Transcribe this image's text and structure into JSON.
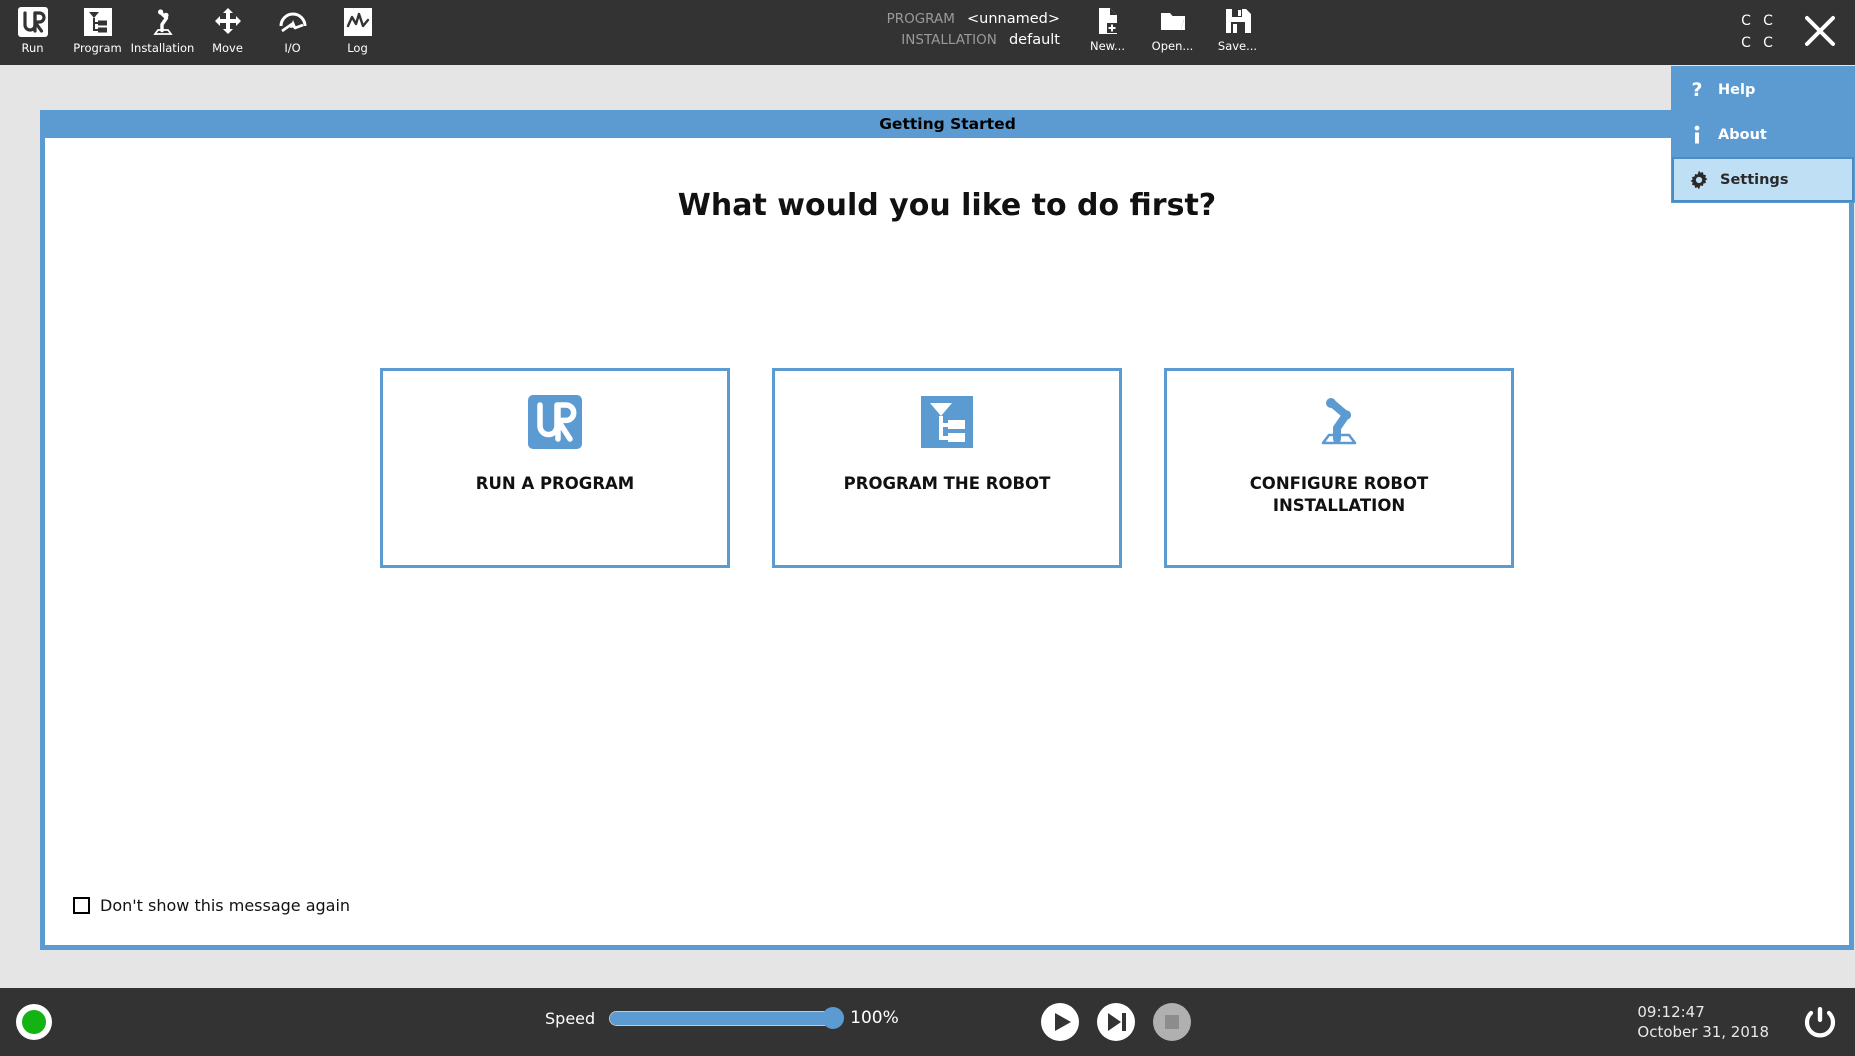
{
  "toolbar": {
    "items": [
      {
        "label": "Run",
        "icon": "ur-logo-icon"
      },
      {
        "label": "Program",
        "icon": "program-tree-icon"
      },
      {
        "label": "Installation",
        "icon": "robot-arm-icon"
      },
      {
        "label": "Move",
        "icon": "move-arrows-icon"
      },
      {
        "label": "I/O",
        "icon": "io-gauge-icon"
      },
      {
        "label": "Log",
        "icon": "log-waveform-icon"
      }
    ]
  },
  "program_info": {
    "program_key": "PROGRAM",
    "program_value": "<unnamed>",
    "installation_key": "INSTALLATION",
    "installation_value": "default"
  },
  "file_actions": [
    {
      "label": "New...",
      "icon": "new-document-icon"
    },
    {
      "label": "Open...",
      "icon": "open-folder-icon"
    },
    {
      "label": "Save...",
      "icon": "save-floppy-icon"
    }
  ],
  "window_controls": {
    "grid_menu_glyphs": [
      "C",
      "C",
      "C",
      "C"
    ],
    "close_icon": "close-x-icon"
  },
  "dropdown": {
    "items": [
      {
        "label": "Help",
        "icon": "question-mark-icon",
        "selected": false
      },
      {
        "label": "About",
        "icon": "info-i-icon",
        "selected": false
      },
      {
        "label": "Settings",
        "icon": "gear-icon",
        "selected": true
      }
    ]
  },
  "getting_started": {
    "title": "Getting Started",
    "heading": "What would you like to do first?",
    "cards": [
      {
        "label": "RUN A PROGRAM",
        "icon": "ur-logo-icon"
      },
      {
        "label": "PROGRAM THE ROBOT",
        "icon": "program-tree-icon"
      },
      {
        "label": "CONFIGURE ROBOT INSTALLATION",
        "icon": "robot-arm-icon"
      }
    ],
    "dont_show_label": "Don't show this message again",
    "dont_show_checked": false
  },
  "status_bar": {
    "robot_state": "normal",
    "speed_label": "Speed",
    "speed_value": "100%",
    "speed_percent": 100,
    "transport": [
      {
        "name": "play-button",
        "icon": "play-icon",
        "enabled": true
      },
      {
        "name": "step-button",
        "icon": "step-icon",
        "enabled": true
      },
      {
        "name": "stop-button",
        "icon": "stop-icon",
        "enabled": false
      }
    ],
    "time": "09:12:47",
    "date": "October 31, 2018",
    "power_icon": "power-icon"
  },
  "colors": {
    "accent_blue": "#5b9bd1",
    "dark_chrome": "#333333",
    "page_grey": "#e5e5e5",
    "selected_blue": "#bfdff5",
    "led_green": "#12b312"
  }
}
